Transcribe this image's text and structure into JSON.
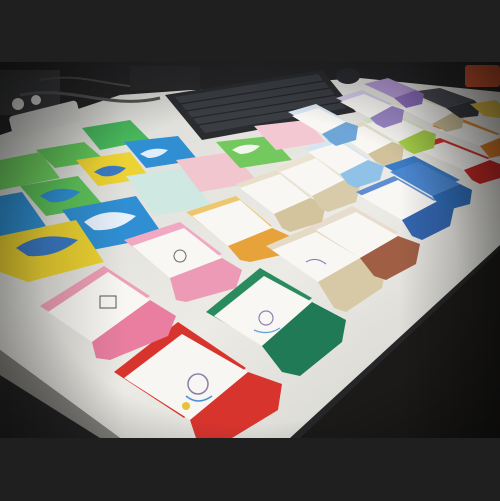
{
  "image": {
    "palette": {
      "frame": "#1f1f1f",
      "desk": "#ecebe6",
      "keyboard": "#2a2c30",
      "green": "#62c65a",
      "blue": "#2f8fd2",
      "yellow": "#ecd232",
      "pink": "#e9a7bd",
      "orange": "#e8a23a",
      "red": "#d8342e",
      "dark_green": "#1f7a55",
      "tan": "#d8c9a6",
      "navy": "#3466b0",
      "brown": "#a05f45",
      "lavender": "#9b88c8",
      "light_blue": "#8fc2e6",
      "lime": "#a8d14a"
    }
  }
}
